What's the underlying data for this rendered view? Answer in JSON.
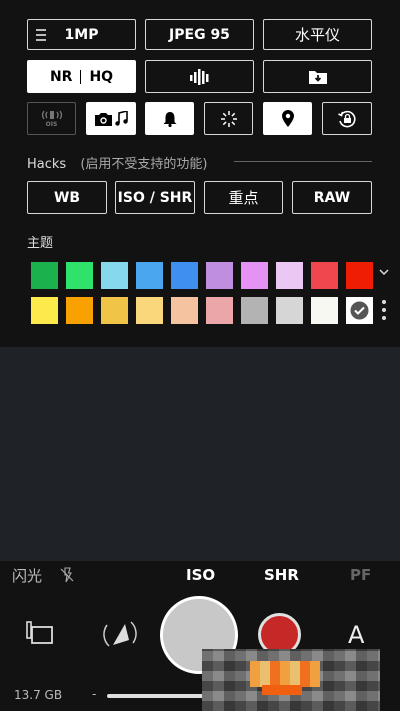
{
  "settings": {
    "row1": {
      "resolution": "1MP",
      "format": "JPEG 95",
      "level": "水平仪"
    },
    "row2": {
      "nr": "NR",
      "hq": "HQ"
    },
    "hacks": {
      "title": "Hacks",
      "subtitle": "(启用不受支持的功能)"
    },
    "hack_buttons": {
      "wb": "WB",
      "iso_shr": "ISO / SHR",
      "focus": "重点",
      "raw": "RAW"
    },
    "theme": {
      "title": "主题"
    },
    "ois_label": "OIS"
  },
  "colors": {
    "theme_row1": [
      "#1bb24e",
      "#2fe36a",
      "#86d8ec",
      "#4aa6ee",
      "#3e8ff0",
      "#bf8ee0",
      "#e492f3",
      "#ebc8f3",
      "#f0474f",
      "#f01d05"
    ],
    "theme_row2": [
      "#fcea4d",
      "#f8a100",
      "#f0c447",
      "#fbd77b",
      "#f6c3a0",
      "#eba6aa",
      "#b3b3b3",
      "#d6d6d6",
      "#f6f8f1",
      "#ffffff"
    ]
  },
  "bottom_bar": {
    "flash": "闪光",
    "iso": "ISO",
    "shr": "SHR",
    "pf": "PF",
    "mode": "A",
    "storage": "13.7 GB",
    "dash": "-"
  }
}
